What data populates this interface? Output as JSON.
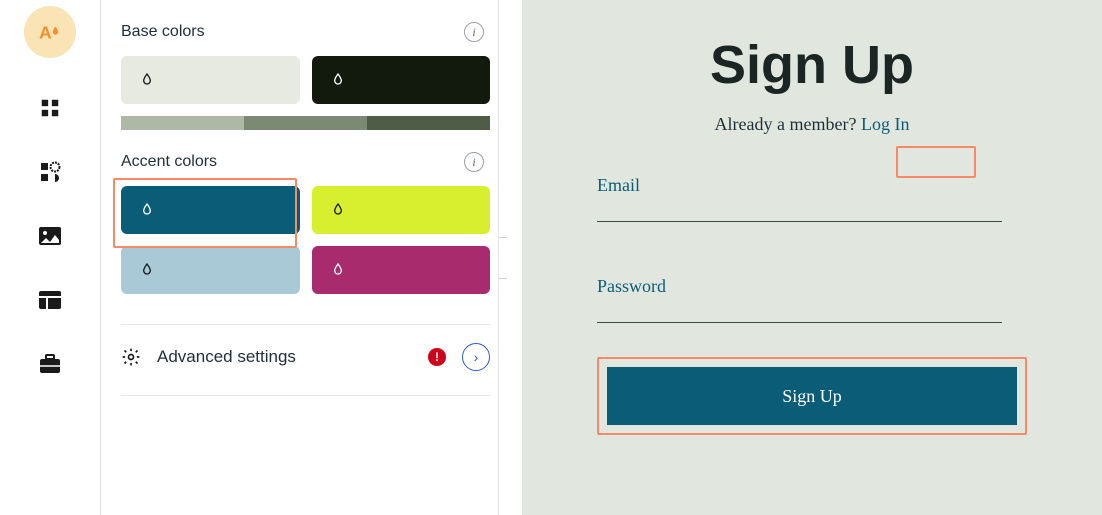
{
  "sidebar": {
    "items": [
      "logo",
      "grid",
      "plugin",
      "image",
      "table",
      "briefcase"
    ]
  },
  "panel": {
    "base_colors_label": "Base colors",
    "accent_colors_label": "Accent colors",
    "advanced_label": "Advanced settings",
    "base_swatches": [
      {
        "name": "light",
        "color": "#e6eae1"
      },
      {
        "name": "dark",
        "color": "#12190d"
      }
    ],
    "base_range": [
      "#adb9a5",
      "#7b8a73",
      "#4f5c46"
    ],
    "accent_swatches": [
      {
        "name": "teal",
        "color": "#0b5d77",
        "selected": true
      },
      {
        "name": "lime",
        "color": "#d7ef2f"
      },
      {
        "name": "lblue",
        "color": "#a9c9d6"
      },
      {
        "name": "magenta",
        "color": "#a72b6d"
      }
    ]
  },
  "preview": {
    "title": "Sign Up",
    "subtitle_prefix": "Already a member? ",
    "login_text": "Log In",
    "email_label": "Email",
    "password_label": "Password",
    "signup_button": "Sign Up"
  }
}
